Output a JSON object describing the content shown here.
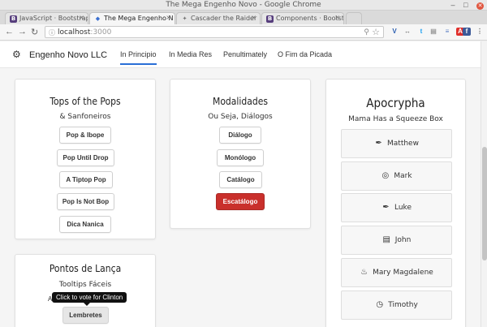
{
  "window": {
    "title": "The Mega Engenho Novo - Google Chrome",
    "controls": [
      "–",
      "□",
      "✕"
    ]
  },
  "tabs": [
    {
      "label": "JavaScript · Bootstrap",
      "icon": "B",
      "icon_color": "#563d7c",
      "active": false
    },
    {
      "label": "The Mega Engenho N",
      "icon": "◆",
      "icon_color": "#3a6fd0",
      "active": true
    },
    {
      "label": "Cascader the Raider",
      "icon": "✦",
      "icon_color": "#888888",
      "active": false
    },
    {
      "label": "Components · Bootstr",
      "icon": "B",
      "icon_color": "#563d7c",
      "active": false
    }
  ],
  "address": {
    "host": "localhost",
    "port": ":3000"
  },
  "navbar": {
    "brand": "Engenho Novo LLC",
    "links": [
      "In Principio",
      "In Media Res",
      "Penultimately",
      "O Fim da Picada"
    ]
  },
  "card1": {
    "title": "Tops of the Pops",
    "subtitle": "& Sanfoneiros",
    "buttons": [
      "Pop & Ibope",
      "Pop Until Drop",
      "A Tiptop Pop",
      "Pop Is Not Bop",
      "Dica Nanica"
    ]
  },
  "card2": {
    "title": "Modalidades",
    "subtitle": "Ou Seja, Diálogos",
    "buttons": [
      "Diálogo",
      "Monólogo",
      "Catálogo",
      "Escatálogo"
    ]
  },
  "card3": {
    "title": "Apocrypha",
    "subtitle": "Mama Has a Squeeze Box",
    "items": [
      {
        "label": "Matthew",
        "icon": "pen-nib-icon"
      },
      {
        "label": "Mark",
        "icon": "bullseye-icon"
      },
      {
        "label": "Luke",
        "icon": "pen-nib-icon"
      },
      {
        "label": "John",
        "icon": "book-icon"
      },
      {
        "label": "Mary Magdalene",
        "icon": "fire-icon"
      },
      {
        "label": "Timothy",
        "icon": "clock-icon"
      }
    ]
  },
  "card4": {
    "title": "Pontos de Lança",
    "subtitle": "Tooltips Fáceis",
    "partial_left": "A",
    "partial_right": "o",
    "tooltip": "Click to vote for Clinton",
    "button": "Lembretes"
  },
  "colors": {
    "accent": "#2a6fd6",
    "danger": "#c9302c"
  }
}
